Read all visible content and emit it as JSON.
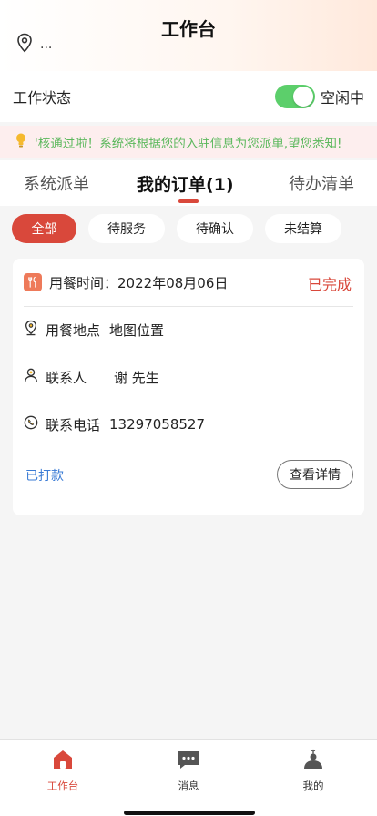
{
  "header": {
    "title": "工作台",
    "location_text": "..."
  },
  "work_status": {
    "label": "工作状态",
    "toggle_on": true,
    "toggle_label": "空闲中"
  },
  "notice": {
    "text": "'核通过啦！系统将根据您的入驻信息为您派单,望您悉知!"
  },
  "tabs": [
    {
      "label": "系统派单",
      "active": false
    },
    {
      "label": "我的订单(1)",
      "active": true
    },
    {
      "label": "待办清单",
      "active": false
    }
  ],
  "filters": [
    {
      "label": "全部",
      "active": true
    },
    {
      "label": "待服务",
      "active": false
    },
    {
      "label": "待确认",
      "active": false
    },
    {
      "label": "未结算",
      "active": false
    }
  ],
  "order": {
    "time_label": "用餐时间：",
    "time_value": "2022年08月06日",
    "status": "已完成",
    "place_label": "用餐地点",
    "place_value": "地图位置",
    "contact_label": "联系人",
    "contact_value": "谢 先生",
    "phone_label": "联系电话",
    "phone_value": "13297058527",
    "payment_status": "已打款",
    "detail_button": "查看详情"
  },
  "bottom_nav": [
    {
      "label": "工作台",
      "icon": "home-icon",
      "active": true
    },
    {
      "label": "消息",
      "icon": "message-icon",
      "active": false
    },
    {
      "label": "我的",
      "icon": "profile-icon",
      "active": false
    }
  ],
  "colors": {
    "accent": "#d9483b",
    "toggle_green": "#5ccf6b",
    "notice_text": "#5bb85c",
    "link_blue": "#3a7bd5"
  }
}
